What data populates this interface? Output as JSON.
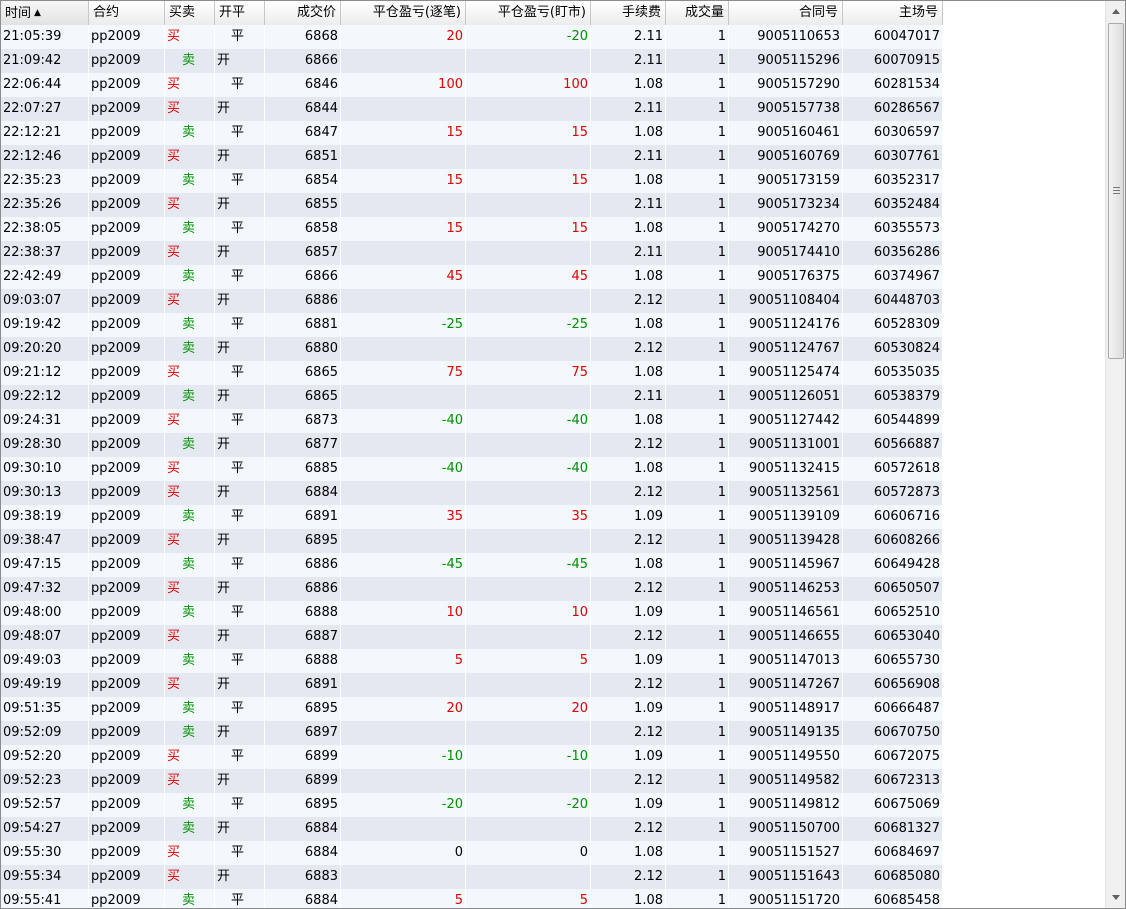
{
  "columns": [
    {
      "key": "time",
      "label": "时间",
      "align": "l",
      "sorted": true
    },
    {
      "key": "contract",
      "label": "合约",
      "align": "l"
    },
    {
      "key": "side",
      "label": "买卖",
      "align": "l"
    },
    {
      "key": "oc",
      "label": "开平",
      "align": "l"
    },
    {
      "key": "price",
      "label": "成交价",
      "align": "r"
    },
    {
      "key": "pnl_daily",
      "label": "平仓盈亏(逐笔)",
      "align": "r"
    },
    {
      "key": "pnl_mark",
      "label": "平仓盈亏(盯市)",
      "align": "r"
    },
    {
      "key": "fee",
      "label": "手续费",
      "align": "r"
    },
    {
      "key": "qty",
      "label": "成交量",
      "align": "r"
    },
    {
      "key": "contract_no",
      "label": "合同号",
      "align": "r"
    },
    {
      "key": "exchange_no",
      "label": "主场号",
      "align": "r"
    }
  ],
  "sort_indicator": "▲",
  "colors": {
    "buy": "#e00000",
    "sell": "#009000",
    "profit": "#e00000",
    "loss": "#009000",
    "row_odd": "#f3f8fd",
    "row_even": "#e4e8f0"
  },
  "rows": [
    {
      "time": "21:05:39",
      "contract": "pp2009",
      "side": "买",
      "oc": "平",
      "price": "6868",
      "pnl_daily": "20",
      "pnl_mark": "-20",
      "fee": "2.11",
      "qty": "1",
      "contract_no": "9005110653",
      "exchange_no": "60047017"
    },
    {
      "time": "21:09:42",
      "contract": "pp2009",
      "side": "卖",
      "oc": "开",
      "price": "6866",
      "pnl_daily": "",
      "pnl_mark": "",
      "fee": "2.11",
      "qty": "1",
      "contract_no": "9005115296",
      "exchange_no": "60070915"
    },
    {
      "time": "22:06:44",
      "contract": "pp2009",
      "side": "买",
      "oc": "平",
      "price": "6846",
      "pnl_daily": "100",
      "pnl_mark": "100",
      "fee": "1.08",
      "qty": "1",
      "contract_no": "9005157290",
      "exchange_no": "60281534"
    },
    {
      "time": "22:07:27",
      "contract": "pp2009",
      "side": "买",
      "oc": "开",
      "price": "6844",
      "pnl_daily": "",
      "pnl_mark": "",
      "fee": "2.11",
      "qty": "1",
      "contract_no": "9005157738",
      "exchange_no": "60286567"
    },
    {
      "time": "22:12:21",
      "contract": "pp2009",
      "side": "卖",
      "oc": "平",
      "price": "6847",
      "pnl_daily": "15",
      "pnl_mark": "15",
      "fee": "1.08",
      "qty": "1",
      "contract_no": "9005160461",
      "exchange_no": "60306597"
    },
    {
      "time": "22:12:46",
      "contract": "pp2009",
      "side": "买",
      "oc": "开",
      "price": "6851",
      "pnl_daily": "",
      "pnl_mark": "",
      "fee": "2.11",
      "qty": "1",
      "contract_no": "9005160769",
      "exchange_no": "60307761"
    },
    {
      "time": "22:35:23",
      "contract": "pp2009",
      "side": "卖",
      "oc": "平",
      "price": "6854",
      "pnl_daily": "15",
      "pnl_mark": "15",
      "fee": "1.08",
      "qty": "1",
      "contract_no": "9005173159",
      "exchange_no": "60352317"
    },
    {
      "time": "22:35:26",
      "contract": "pp2009",
      "side": "买",
      "oc": "开",
      "price": "6855",
      "pnl_daily": "",
      "pnl_mark": "",
      "fee": "2.11",
      "qty": "1",
      "contract_no": "9005173234",
      "exchange_no": "60352484"
    },
    {
      "time": "22:38:05",
      "contract": "pp2009",
      "side": "卖",
      "oc": "平",
      "price": "6858",
      "pnl_daily": "15",
      "pnl_mark": "15",
      "fee": "1.08",
      "qty": "1",
      "contract_no": "9005174270",
      "exchange_no": "60355573"
    },
    {
      "time": "22:38:37",
      "contract": "pp2009",
      "side": "买",
      "oc": "开",
      "price": "6857",
      "pnl_daily": "",
      "pnl_mark": "",
      "fee": "2.11",
      "qty": "1",
      "contract_no": "9005174410",
      "exchange_no": "60356286"
    },
    {
      "time": "22:42:49",
      "contract": "pp2009",
      "side": "卖",
      "oc": "平",
      "price": "6866",
      "pnl_daily": "45",
      "pnl_mark": "45",
      "fee": "1.08",
      "qty": "1",
      "contract_no": "9005176375",
      "exchange_no": "60374967"
    },
    {
      "time": "09:03:07",
      "contract": "pp2009",
      "side": "买",
      "oc": "开",
      "price": "6886",
      "pnl_daily": "",
      "pnl_mark": "",
      "fee": "2.12",
      "qty": "1",
      "contract_no": "90051108404",
      "exchange_no": "60448703"
    },
    {
      "time": "09:19:42",
      "contract": "pp2009",
      "side": "卖",
      "oc": "平",
      "price": "6881",
      "pnl_daily": "-25",
      "pnl_mark": "-25",
      "fee": "1.08",
      "qty": "1",
      "contract_no": "90051124176",
      "exchange_no": "60528309"
    },
    {
      "time": "09:20:20",
      "contract": "pp2009",
      "side": "卖",
      "oc": "开",
      "price": "6880",
      "pnl_daily": "",
      "pnl_mark": "",
      "fee": "2.12",
      "qty": "1",
      "contract_no": "90051124767",
      "exchange_no": "60530824"
    },
    {
      "time": "09:21:12",
      "contract": "pp2009",
      "side": "买",
      "oc": "平",
      "price": "6865",
      "pnl_daily": "75",
      "pnl_mark": "75",
      "fee": "1.08",
      "qty": "1",
      "contract_no": "90051125474",
      "exchange_no": "60535035"
    },
    {
      "time": "09:22:12",
      "contract": "pp2009",
      "side": "卖",
      "oc": "开",
      "price": "6865",
      "pnl_daily": "",
      "pnl_mark": "",
      "fee": "2.11",
      "qty": "1",
      "contract_no": "90051126051",
      "exchange_no": "60538379"
    },
    {
      "time": "09:24:31",
      "contract": "pp2009",
      "side": "买",
      "oc": "平",
      "price": "6873",
      "pnl_daily": "-40",
      "pnl_mark": "-40",
      "fee": "1.08",
      "qty": "1",
      "contract_no": "90051127442",
      "exchange_no": "60544899"
    },
    {
      "time": "09:28:30",
      "contract": "pp2009",
      "side": "卖",
      "oc": "开",
      "price": "6877",
      "pnl_daily": "",
      "pnl_mark": "",
      "fee": "2.12",
      "qty": "1",
      "contract_no": "90051131001",
      "exchange_no": "60566887"
    },
    {
      "time": "09:30:10",
      "contract": "pp2009",
      "side": "买",
      "oc": "平",
      "price": "6885",
      "pnl_daily": "-40",
      "pnl_mark": "-40",
      "fee": "1.08",
      "qty": "1",
      "contract_no": "90051132415",
      "exchange_no": "60572618"
    },
    {
      "time": "09:30:13",
      "contract": "pp2009",
      "side": "买",
      "oc": "开",
      "price": "6884",
      "pnl_daily": "",
      "pnl_mark": "",
      "fee": "2.12",
      "qty": "1",
      "contract_no": "90051132561",
      "exchange_no": "60572873"
    },
    {
      "time": "09:38:19",
      "contract": "pp2009",
      "side": "卖",
      "oc": "平",
      "price": "6891",
      "pnl_daily": "35",
      "pnl_mark": "35",
      "fee": "1.09",
      "qty": "1",
      "contract_no": "90051139109",
      "exchange_no": "60606716"
    },
    {
      "time": "09:38:47",
      "contract": "pp2009",
      "side": "买",
      "oc": "开",
      "price": "6895",
      "pnl_daily": "",
      "pnl_mark": "",
      "fee": "2.12",
      "qty": "1",
      "contract_no": "90051139428",
      "exchange_no": "60608266"
    },
    {
      "time": "09:47:15",
      "contract": "pp2009",
      "side": "卖",
      "oc": "平",
      "price": "6886",
      "pnl_daily": "-45",
      "pnl_mark": "-45",
      "fee": "1.08",
      "qty": "1",
      "contract_no": "90051145967",
      "exchange_no": "60649428"
    },
    {
      "time": "09:47:32",
      "contract": "pp2009",
      "side": "买",
      "oc": "开",
      "price": "6886",
      "pnl_daily": "",
      "pnl_mark": "",
      "fee": "2.12",
      "qty": "1",
      "contract_no": "90051146253",
      "exchange_no": "60650507"
    },
    {
      "time": "09:48:00",
      "contract": "pp2009",
      "side": "卖",
      "oc": "平",
      "price": "6888",
      "pnl_daily": "10",
      "pnl_mark": "10",
      "fee": "1.09",
      "qty": "1",
      "contract_no": "90051146561",
      "exchange_no": "60652510"
    },
    {
      "time": "09:48:07",
      "contract": "pp2009",
      "side": "买",
      "oc": "开",
      "price": "6887",
      "pnl_daily": "",
      "pnl_mark": "",
      "fee": "2.12",
      "qty": "1",
      "contract_no": "90051146655",
      "exchange_no": "60653040"
    },
    {
      "time": "09:49:03",
      "contract": "pp2009",
      "side": "卖",
      "oc": "平",
      "price": "6888",
      "pnl_daily": "5",
      "pnl_mark": "5",
      "fee": "1.09",
      "qty": "1",
      "contract_no": "90051147013",
      "exchange_no": "60655730"
    },
    {
      "time": "09:49:19",
      "contract": "pp2009",
      "side": "买",
      "oc": "开",
      "price": "6891",
      "pnl_daily": "",
      "pnl_mark": "",
      "fee": "2.12",
      "qty": "1",
      "contract_no": "90051147267",
      "exchange_no": "60656908"
    },
    {
      "time": "09:51:35",
      "contract": "pp2009",
      "side": "卖",
      "oc": "平",
      "price": "6895",
      "pnl_daily": "20",
      "pnl_mark": "20",
      "fee": "1.09",
      "qty": "1",
      "contract_no": "90051148917",
      "exchange_no": "60666487"
    },
    {
      "time": "09:52:09",
      "contract": "pp2009",
      "side": "卖",
      "oc": "开",
      "price": "6897",
      "pnl_daily": "",
      "pnl_mark": "",
      "fee": "2.12",
      "qty": "1",
      "contract_no": "90051149135",
      "exchange_no": "60670750"
    },
    {
      "time": "09:52:20",
      "contract": "pp2009",
      "side": "买",
      "oc": "平",
      "price": "6899",
      "pnl_daily": "-10",
      "pnl_mark": "-10",
      "fee": "1.09",
      "qty": "1",
      "contract_no": "90051149550",
      "exchange_no": "60672075"
    },
    {
      "time": "09:52:23",
      "contract": "pp2009",
      "side": "买",
      "oc": "开",
      "price": "6899",
      "pnl_daily": "",
      "pnl_mark": "",
      "fee": "2.12",
      "qty": "1",
      "contract_no": "90051149582",
      "exchange_no": "60672313"
    },
    {
      "time": "09:52:57",
      "contract": "pp2009",
      "side": "卖",
      "oc": "平",
      "price": "6895",
      "pnl_daily": "-20",
      "pnl_mark": "-20",
      "fee": "1.09",
      "qty": "1",
      "contract_no": "90051149812",
      "exchange_no": "60675069"
    },
    {
      "time": "09:54:27",
      "contract": "pp2009",
      "side": "卖",
      "oc": "开",
      "price": "6884",
      "pnl_daily": "",
      "pnl_mark": "",
      "fee": "2.12",
      "qty": "1",
      "contract_no": "90051150700",
      "exchange_no": "60681327"
    },
    {
      "time": "09:55:30",
      "contract": "pp2009",
      "side": "买",
      "oc": "平",
      "price": "6884",
      "pnl_daily": "0",
      "pnl_mark": "0",
      "fee": "1.08",
      "qty": "1",
      "contract_no": "90051151527",
      "exchange_no": "60684697"
    },
    {
      "time": "09:55:34",
      "contract": "pp2009",
      "side": "买",
      "oc": "开",
      "price": "6883",
      "pnl_daily": "",
      "pnl_mark": "",
      "fee": "2.12",
      "qty": "1",
      "contract_no": "90051151643",
      "exchange_no": "60685080"
    },
    {
      "time": "09:55:41",
      "contract": "pp2009",
      "side": "卖",
      "oc": "平",
      "price": "6884",
      "pnl_daily": "5",
      "pnl_mark": "5",
      "fee": "1.08",
      "qty": "1",
      "contract_no": "90051151720",
      "exchange_no": "60685458"
    }
  ]
}
